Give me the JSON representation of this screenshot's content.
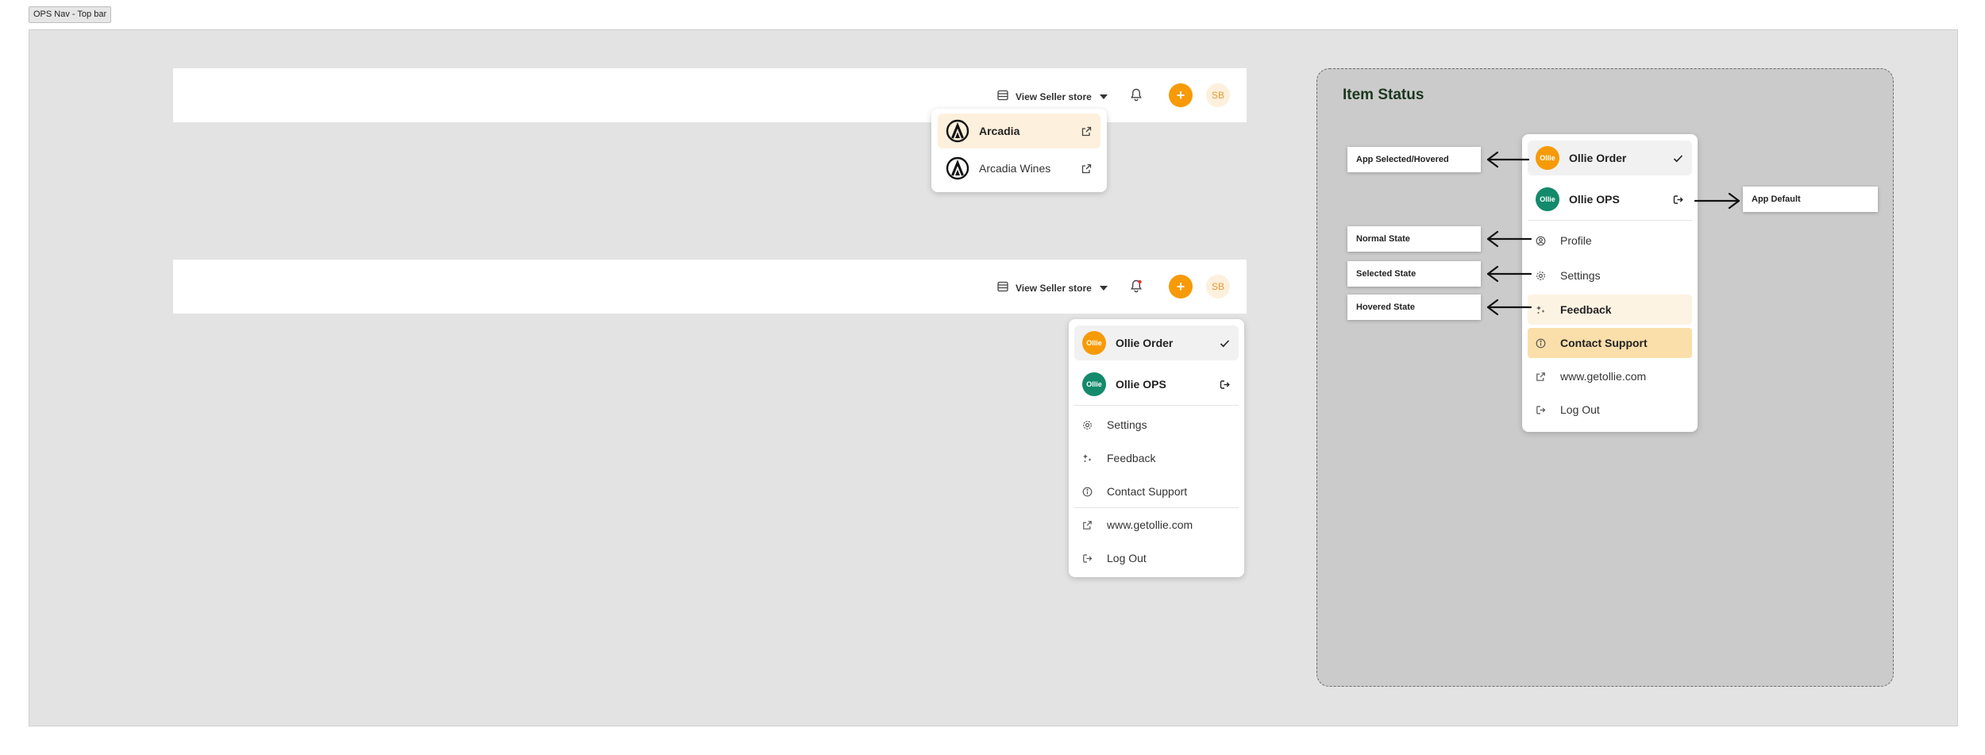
{
  "frame_label": "OPS Nav - Top bar",
  "topbar": {
    "store_label": "View Seller store",
    "avatar_initials": "SB",
    "plus_symbol": "+"
  },
  "store_menu": {
    "items": [
      {
        "label": "Arcadia",
        "state": "selected"
      },
      {
        "label": "Arcadia Wines",
        "state": "default"
      }
    ]
  },
  "apps": {
    "order": {
      "name": "Ollie Order",
      "logo_text": "Ollie",
      "color": "#f79a07"
    },
    "ops": {
      "name": "Ollie OPS",
      "logo_text": "Ollie",
      "color": "#138a6b"
    }
  },
  "user_menu": {
    "items": [
      "Settings",
      "Feedback",
      "Contact Support",
      "www.getollie.com",
      "Log Out"
    ]
  },
  "status_panel": {
    "title": "Item Status",
    "items": [
      "Profile",
      "Settings",
      "Feedback",
      "Contact Support",
      "www.getollie.com",
      "Log Out"
    ],
    "annotations": {
      "app_selected": "App Selected/Hovered",
      "app_default": "App Default",
      "normal": "Normal State",
      "selected": "Selected State",
      "hovered": "Hovered State"
    }
  },
  "colors": {
    "accent": "#f79a07",
    "ops_green": "#138a6b",
    "hover_bg": "#fdf3e3",
    "selected_bg": "#fbdfaa"
  }
}
